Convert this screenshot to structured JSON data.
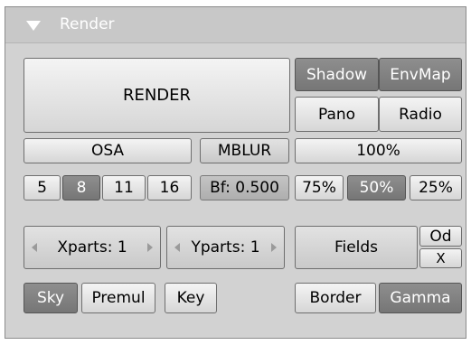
{
  "panel": {
    "title": "Render"
  },
  "render_button": "RENDER",
  "toggles": {
    "shadow": "Shadow",
    "envmap": "EnvMap",
    "pano": "Pano",
    "radio": "Radio"
  },
  "osa": {
    "label": "OSA",
    "levels": [
      "5",
      "8",
      "11",
      "16"
    ],
    "selected": "8"
  },
  "mblur": {
    "label": "MBLUR",
    "bf": "Bf: 0.500"
  },
  "size": {
    "label": "100%",
    "options": [
      "75%",
      "50%",
      "25%"
    ],
    "selected": "50%"
  },
  "parts": {
    "xparts": "Xparts: 1",
    "yparts": "Yparts: 1"
  },
  "fields": {
    "label": "Fields",
    "od": "Od",
    "x": "X"
  },
  "bottom": {
    "sky": "Sky",
    "premul": "Premul",
    "key": "Key",
    "border": "Border",
    "gamma": "Gamma"
  },
  "colors": {
    "active": "#7e7e7e",
    "panel": "#d2d2d2",
    "button": "#e6e6e6"
  }
}
